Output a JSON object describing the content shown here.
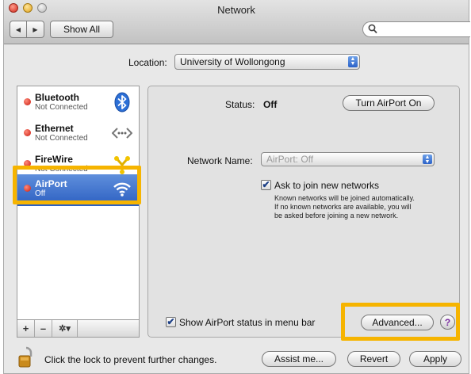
{
  "window": {
    "title": "Network"
  },
  "toolbar": {
    "back_glyph": "◀",
    "forward_glyph": "▶",
    "show_all_label": "Show All",
    "search": {
      "value": "",
      "placeholder": ""
    }
  },
  "location": {
    "label": "Location:",
    "value": "University of Wollongong"
  },
  "services": [
    {
      "name": "Bluetooth",
      "status": "Not Connected",
      "icon": "bluetooth-icon",
      "selected": false
    },
    {
      "name": "Ethernet",
      "status": "Not Connected",
      "icon": "ethernet-icon",
      "selected": false
    },
    {
      "name": "FireWire",
      "status": "Not Connected",
      "icon": "firewire-icon",
      "selected": false
    },
    {
      "name": "AirPort",
      "status": "Off",
      "icon": "wifi-icon",
      "selected": true
    }
  ],
  "sidebar_tools": {
    "add": "+",
    "remove": "–",
    "gear": "✲▾"
  },
  "detail": {
    "status_label": "Status:",
    "status_value": "Off",
    "turn_on_label": "Turn AirPort On",
    "network_name_label": "Network Name:",
    "network_name_value": "AirPort: Off",
    "ask_label": "Ask to join new networks",
    "ask_checked": true,
    "ask_help": [
      "Known networks will be joined automatically.",
      "If no known networks are available, you will",
      "be asked before joining a new network."
    ],
    "show_status_label": "Show AirPort status in menu bar",
    "show_status_checked": true,
    "advanced_label": "Advanced...",
    "help_label": "?"
  },
  "footer": {
    "lock_text": "Click the lock to prevent further changes.",
    "assist_label": "Assist me...",
    "revert_label": "Revert",
    "apply_label": "Apply"
  },
  "colors": {
    "selection": "#2c5fc1",
    "highlight": "#f6b400",
    "status_dot": "#c81a0e"
  }
}
